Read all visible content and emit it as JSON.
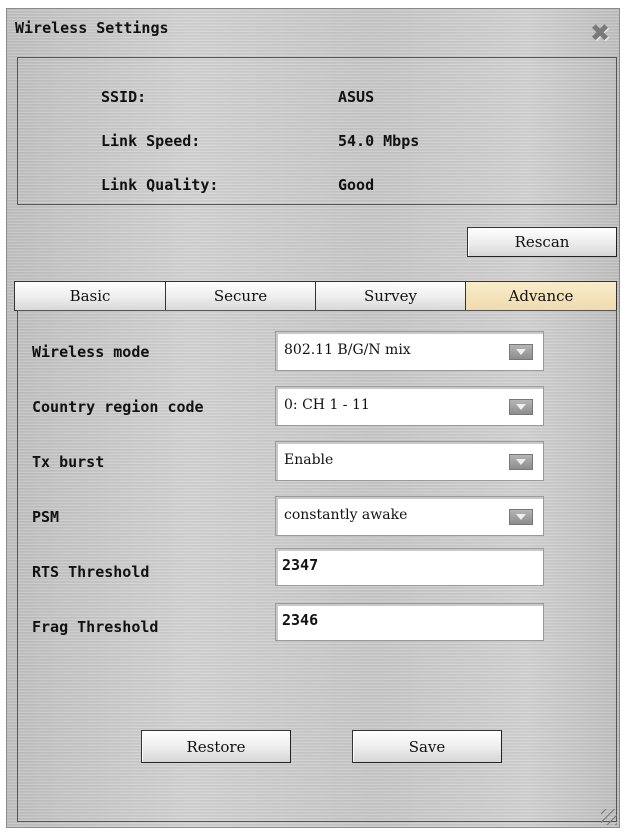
{
  "window": {
    "title": "Wireless Settings",
    "close_icon": "close-icon"
  },
  "status": {
    "ssid_label": "SSID:",
    "ssid_value": "ASUS",
    "speed_label": "Link Speed:",
    "speed_value": "54.0 Mbps",
    "quality_label": "Link Quality:",
    "quality_value": "Good"
  },
  "rescan_label": "Rescan",
  "tabs": [
    {
      "label": "Basic",
      "active": false
    },
    {
      "label": "Secure",
      "active": false
    },
    {
      "label": "Survey",
      "active": false
    },
    {
      "label": "Advance",
      "active": true
    }
  ],
  "colors": {
    "active_tab": "#efdcae"
  },
  "fields": {
    "wireless_mode": {
      "label": "Wireless mode",
      "value": "802.11 B/G/N mix"
    },
    "country_region": {
      "label": "Country region code",
      "value": "0: CH 1 - 11"
    },
    "tx_burst": {
      "label": "Tx burst",
      "value": "Enable"
    },
    "psm": {
      "label": "PSM",
      "value": "constantly awake"
    },
    "rts_threshold": {
      "label": "RTS Threshold",
      "value": "2347"
    },
    "frag_threshold": {
      "label": "Frag Threshold",
      "value": "2346"
    }
  },
  "buttons": {
    "restore": "Restore",
    "save": "Save"
  }
}
